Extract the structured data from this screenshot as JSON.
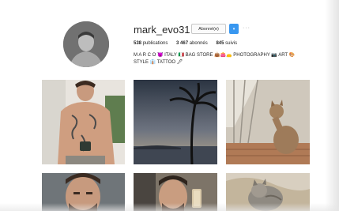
{
  "profile": {
    "username": "mark_evo31",
    "follow_label": "Abonné(e)",
    "dropdown_icon": "chevron-down-icon",
    "more_icon": "···",
    "stats": [
      {
        "value": "538",
        "label": "publications"
      },
      {
        "value": "3 467",
        "label": "abonnés"
      },
      {
        "value": "845",
        "label": "suivis"
      }
    ],
    "bio_line1": "M A R C O 😈 ITALY 🇮🇹 BAG STORE 👜👛👝 PHOTOGRAPHY 📷 ART 🎨",
    "bio_line2": "STYLE 👔 TATTOO 🖋"
  },
  "colors": {
    "accent": "#3897f0",
    "text": "#262626"
  },
  "posts": [
    {
      "subject": "shirtless-tattoo-man-with-mug"
    },
    {
      "subject": "palm-tree-sunset"
    },
    {
      "subject": "cat-on-balcony"
    },
    {
      "subject": "man-portrait-bearded"
    },
    {
      "subject": "man-mirror-selfie"
    },
    {
      "subject": "cat-on-blanket"
    }
  ]
}
